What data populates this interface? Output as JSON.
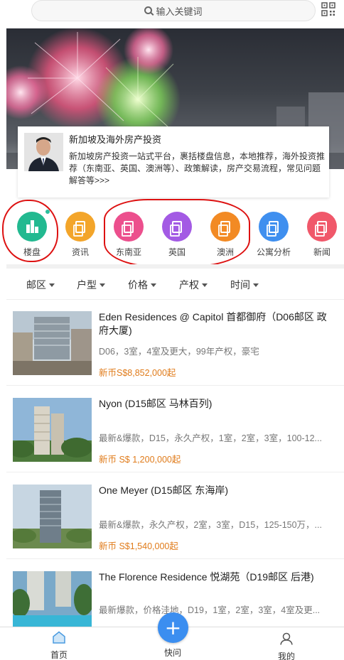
{
  "search": {
    "placeholder": "输入关键词"
  },
  "card": {
    "title": "新加坡及海外房产投资",
    "desc": "新加坡房产投资一站式平台，裹括楼盘信息，本地推荐，海外投资推荐（东南亚、英国、澳洲等）、政策解读，房产交易流程，常见问题解答等>>>"
  },
  "categories": [
    {
      "label": "楼盘",
      "color": "#22b990"
    },
    {
      "label": "资讯",
      "color": "#f3a52a"
    },
    {
      "label": "东南亚",
      "color": "#ec4f8d"
    },
    {
      "label": "英国",
      "color": "#a35ae4"
    },
    {
      "label": "澳洲",
      "color": "#f28a24"
    },
    {
      "label": "公寓分析",
      "color": "#3f8fef"
    },
    {
      "label": "新闻",
      "color": "#f0586a"
    }
  ],
  "filters": [
    "邮区",
    "户型",
    "价格",
    "产权",
    "时间"
  ],
  "listings": [
    {
      "title": "Eden Residences @ Capitol 首都御府（D06邮区 政府大厦)",
      "tags": "D06，3室，4室及更大，99年产权，豪宅",
      "price": "新币S$8,852,000起"
    },
    {
      "title": "Nyon (D15邮区 马林百列)",
      "tags": "最新&爆款，D15，永久产权，1室，2室，3室，100-12...",
      "price": "新币 S$ 1,200,000起"
    },
    {
      "title": "One Meyer (D15邮区 东海岸)",
      "tags": "最新&爆款，永久产权，2室，3室，D15，125-150万，...",
      "price": "新币 S$1,540,000起"
    },
    {
      "title": "The Florence Residence 悦湖苑（D19邮区 后港)",
      "tags": "最新爆款，价格洼地，D19，1室，2室，3室，4室及更...",
      "price": ""
    }
  ],
  "nav": {
    "home": "首页",
    "quick": "快问",
    "mine": "我的"
  },
  "colors": {
    "accent": "#3b8ef0",
    "price": "#e07b1a",
    "annotation": "#dd1111"
  }
}
